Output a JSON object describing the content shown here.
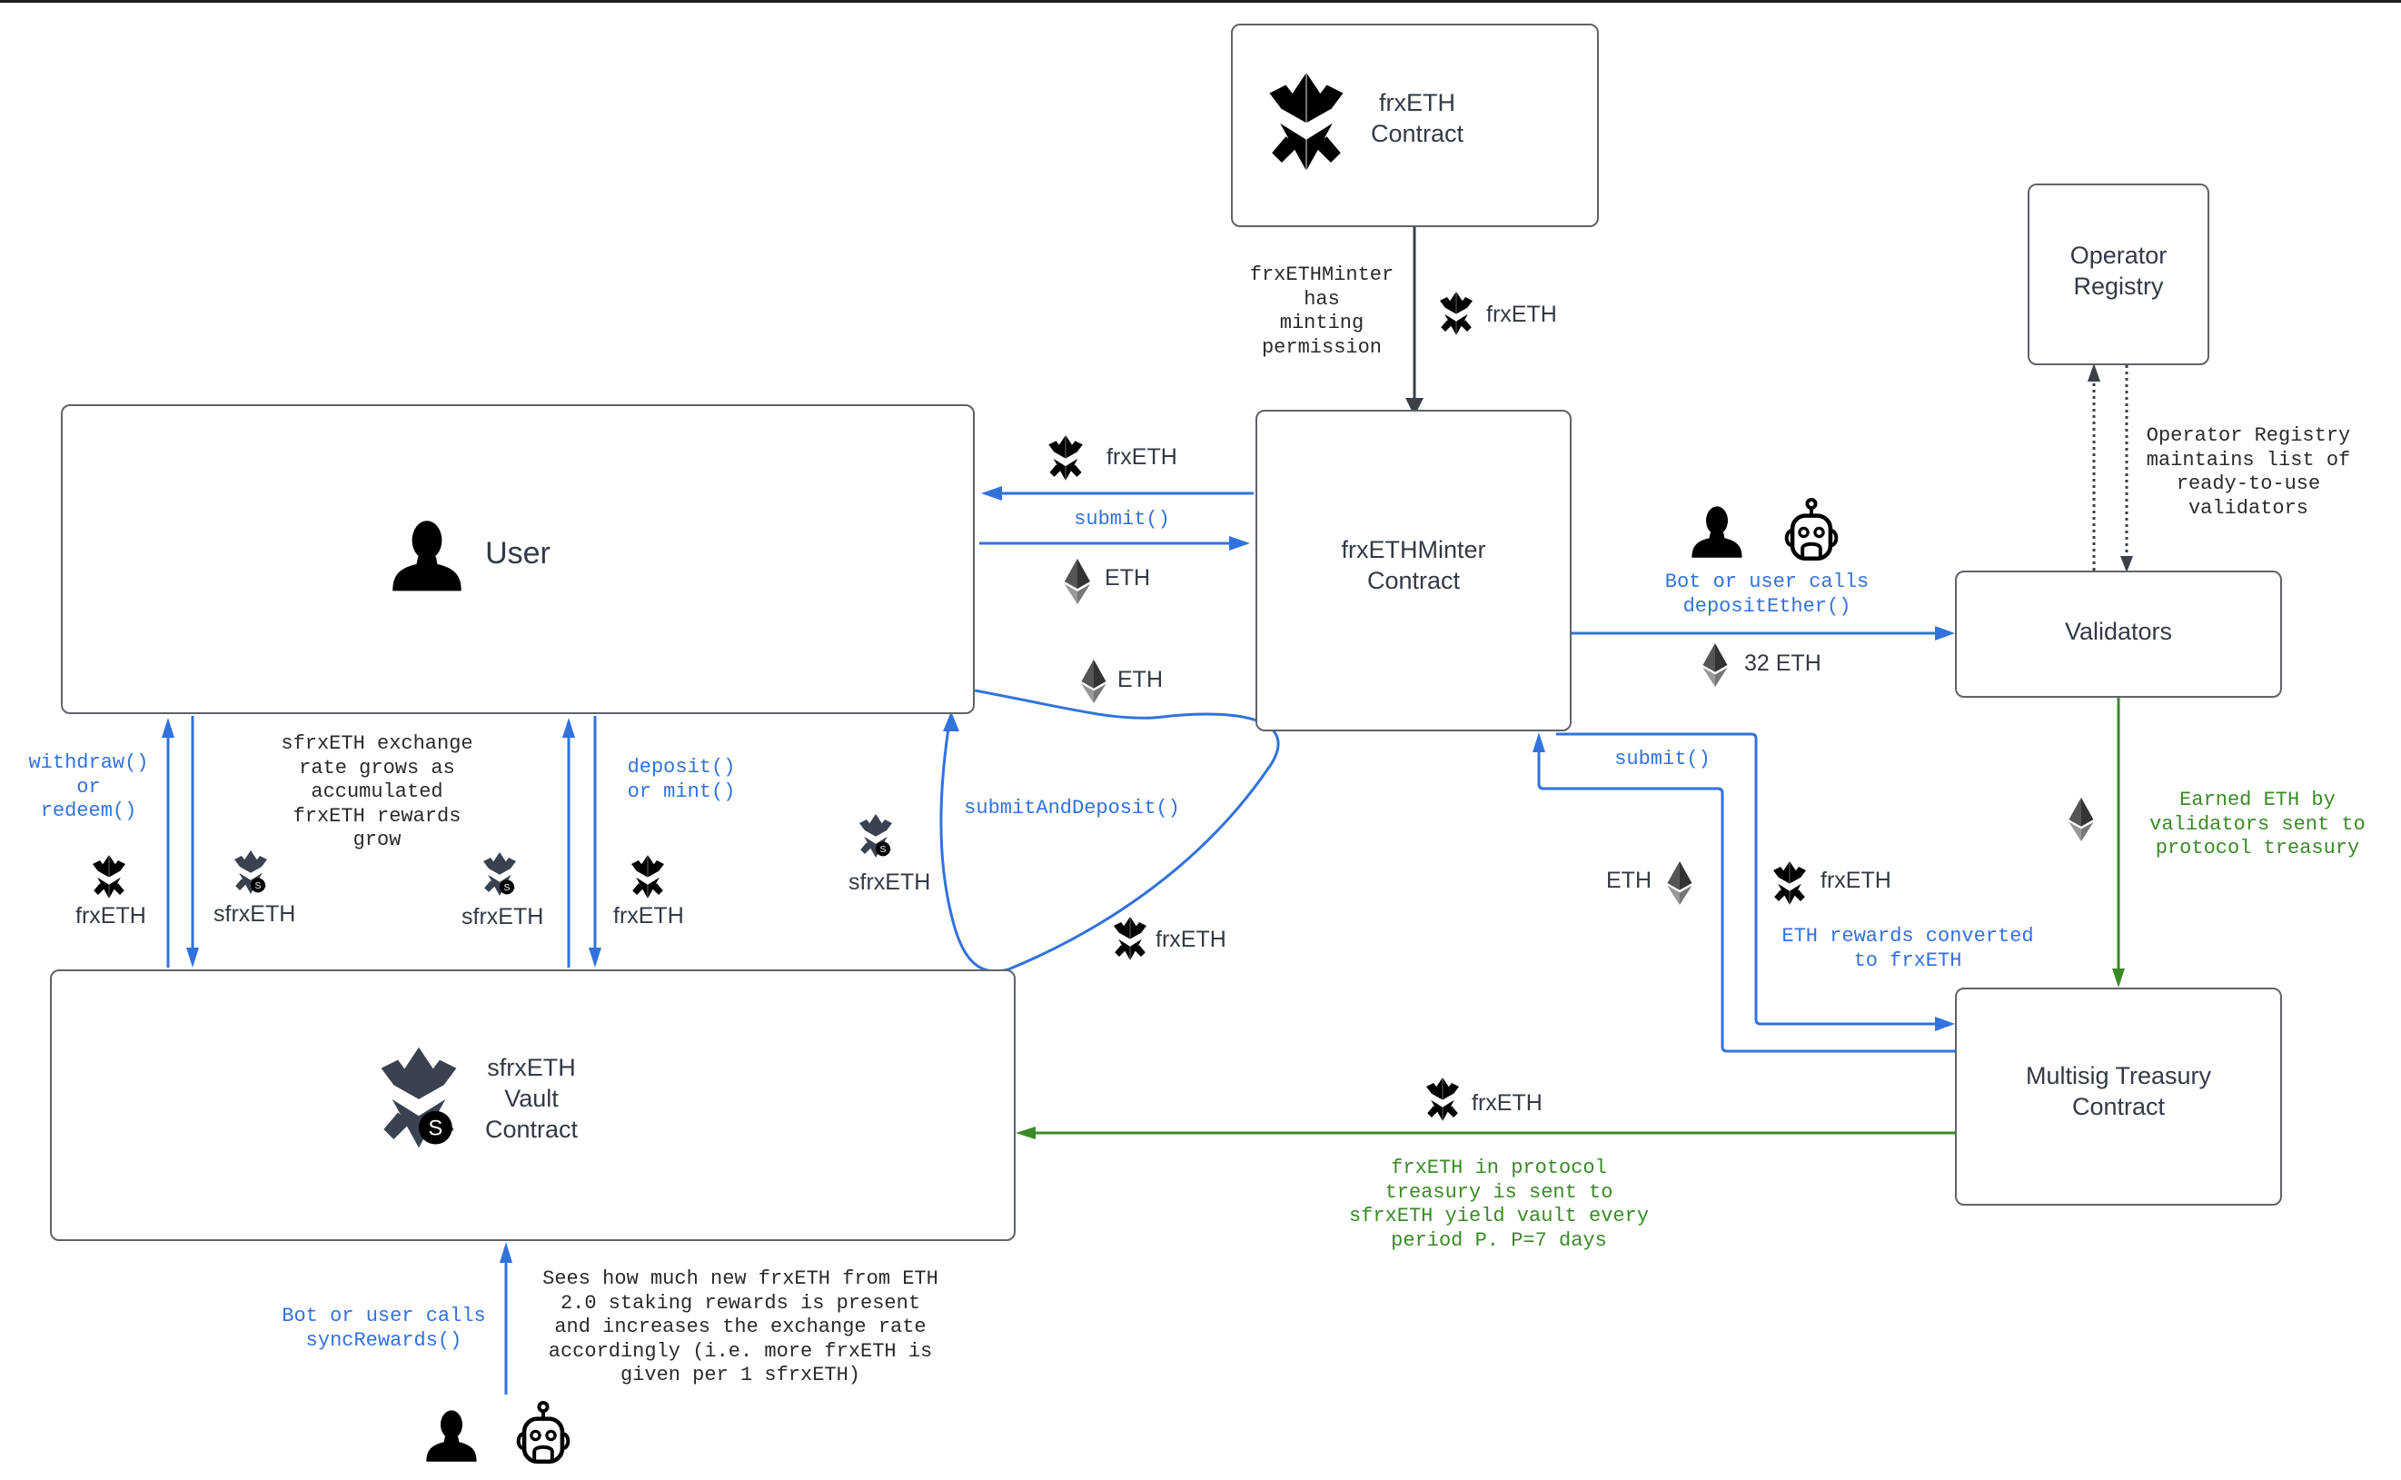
{
  "nodes": {
    "frxeth_contract": "frxETH\nContract",
    "user": "User",
    "minter": "frxETHMinter\nContract",
    "operator_registry": "Operator\nRegistry",
    "validators": "Validators",
    "multisig": "Multisig Treasury\nContract",
    "vault": "sfrxETH\nVault\nContract"
  },
  "edges": {
    "minting_permission": "frxETHMinter\nhas\nminting\npermission",
    "minter_frxeth_token": "frxETH",
    "minter_to_user_token": "frxETH",
    "submit": "submit()",
    "user_to_minter_token": "ETH",
    "submit_and_deposit": "submitAndDeposit()",
    "sad_eth_token": "ETH",
    "sad_frxeth_token": "frxETH",
    "sad_sfrxeth_token": "sfrxETH",
    "deposit_ether": "Bot or user calls\ndepositEther()",
    "deposit_ether_token": "32 ETH",
    "operator_note": "Operator Registry\nmaintains list of\nready-to-use\nvalidators",
    "earned_eth_note": "Earned ETH by\nvalidators sent to\nprotocol treasury",
    "treasury_submit": "submit()",
    "treasury_eth_token": "ETH",
    "treasury_frxeth_token": "frxETH",
    "rewards_converted": "ETH rewards converted\nto frxETH",
    "treasury_to_vault_token": "frxETH",
    "treasury_to_vault_note": "frxETH in protocol\ntreasury is sent to\nsfrxETH yield vault every\nperiod P. P=7 days",
    "withdraw": "withdraw()\nor\nredeem()",
    "withdraw_frxeth_token": "frxETH",
    "withdraw_sfrxeth_token": "sfrxETH",
    "exchange_rate_note": "sfrxETH exchange\nrate grows as\naccumulated\nfrxETH rewards\ngrow",
    "deposit_mint": "deposit()\nor mint()",
    "deposit_sfrxeth_token": "sfrxETH",
    "deposit_frxeth_token": "frxETH",
    "sync_rewards": "Bot or user calls\nsyncRewards()",
    "sync_note": "Sees how much new frxETH from ETH\n2.0 staking rewards is present\nand increases the exchange rate\naccordingly (i.e. more frxETH is\ngiven per 1 sfrxETH)"
  },
  "colors": {
    "flow_blue": "#3272dc",
    "reward_green": "#3a8a26",
    "neutral_arrow": "#3b4048",
    "box_border": "#5f6368"
  }
}
